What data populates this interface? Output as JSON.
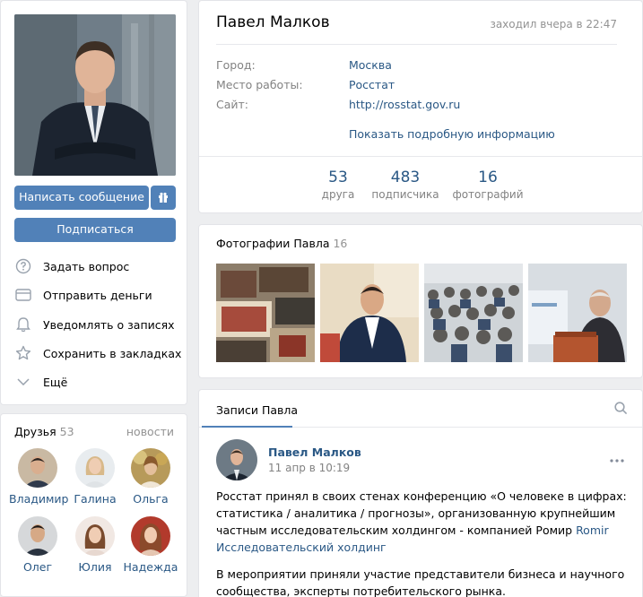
{
  "profile": {
    "name": "Павел Малков",
    "last_seen": "заходил вчера в 22:47",
    "info": [
      {
        "key": "Город:",
        "value": "Москва"
      },
      {
        "key": "Место работы:",
        "value": "Росстат"
      },
      {
        "key": "Сайт:",
        "value": "http://rosstat.gov.ru"
      }
    ],
    "more_info": "Показать подробную информацию",
    "counters": [
      {
        "num": "53",
        "label": "друга"
      },
      {
        "num": "483",
        "label": "подписчика"
      },
      {
        "num": "16",
        "label": "фотографий"
      }
    ]
  },
  "left": {
    "write_message": "Написать сообщение",
    "subscribe": "Подписаться",
    "actions": [
      {
        "label": "Задать вопрос",
        "icon": "question-icon"
      },
      {
        "label": "Отправить деньги",
        "icon": "money-card-icon"
      },
      {
        "label": "Уведомлять о записях",
        "icon": "bell-icon"
      },
      {
        "label": "Сохранить в закладках",
        "icon": "star-icon"
      },
      {
        "label": "Ещё",
        "icon": "chevron-down-icon"
      }
    ]
  },
  "friends": {
    "title": "Друзья",
    "count": "53",
    "news_link": "новости",
    "list": [
      "Владимир",
      "Галина",
      "Ольга",
      "Олег",
      "Юлия",
      "Надежда"
    ]
  },
  "photos": {
    "title": "Фотографии Павла",
    "count": "16"
  },
  "wall": {
    "tab": "Записи Павла",
    "post": {
      "author": "Павел Малков",
      "date": "11 апр в 10:19",
      "text_before_link": "Росстат принял в своих стенах конференцию «О человеке в цифрах: статистика / аналитика / прогнозы», организованную крупнейшим частным исследовательским холдингом - компанией Ромир ",
      "link": "Romir Исследовательский холдинг",
      "text2": "В мероприятии приняли участие представители бизнеса и научного сообщества, эксперты потребительского рынка."
    }
  },
  "colors": {
    "accent": "#5181b8",
    "link": "#2a5885",
    "background": "#edeef0"
  }
}
